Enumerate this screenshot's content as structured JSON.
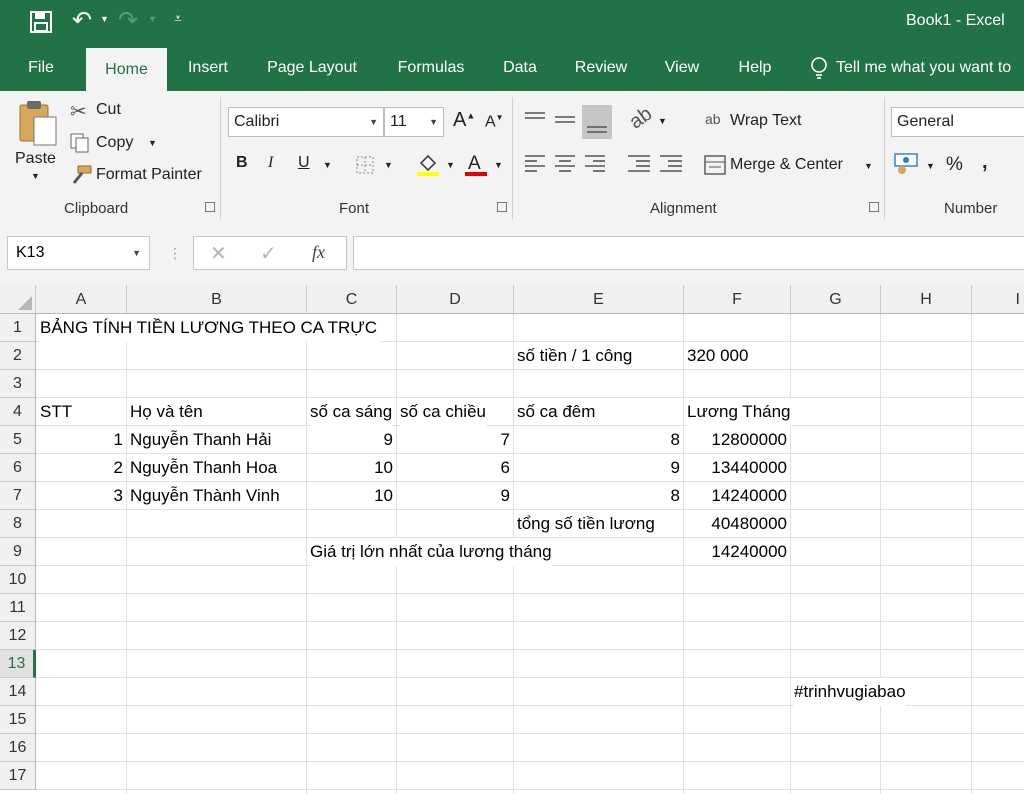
{
  "window": {
    "title": "Book1  -  Excel"
  },
  "tabs": [
    "File",
    "Home",
    "Insert",
    "Page Layout",
    "Formulas",
    "Data",
    "Review",
    "View",
    "Help"
  ],
  "tell_me": "Tell me what you want to",
  "clipboard": {
    "paste": "Paste",
    "cut": "Cut",
    "copy": "Copy",
    "format_painter": "Format Painter",
    "group": "Clipboard"
  },
  "font": {
    "name": "Calibri",
    "size": "11",
    "bold": "B",
    "italic": "I",
    "underline": "U",
    "group": "Font"
  },
  "alignment": {
    "wrap": "Wrap Text",
    "merge": "Merge & Center",
    "group": "Alignment"
  },
  "number": {
    "format": "General",
    "percent": "%",
    "comma": ",",
    "group": "Number"
  },
  "formula_bar": {
    "name_box": "K13",
    "fx": "fx",
    "value": ""
  },
  "columns": [
    "A",
    "B",
    "C",
    "D",
    "E",
    "F",
    "G",
    "H",
    "I"
  ],
  "rows": [
    "1",
    "2",
    "3",
    "4",
    "5",
    "6",
    "7",
    "8",
    "9",
    "10",
    "11",
    "12",
    "13",
    "14",
    "15",
    "16",
    "17"
  ],
  "cells": {
    "A1": "BẢNG TÍNH TIỀN LƯƠNG THEO CA TRỰC",
    "E2": "số tiền / 1 công",
    "F2": "320 000",
    "A4": "STT",
    "B4": "Họ và tên",
    "C4": "số ca sáng",
    "D4": "số ca chiều",
    "E4": "số ca đêm",
    "F4": "Lương Tháng",
    "A5": "1",
    "B5": "Nguyễn Thanh Hải",
    "C5": "9",
    "D5": "7",
    "E5": "8",
    "F5": "12800000",
    "A6": "2",
    "B6": "Nguyễn Thanh Hoa",
    "C6": "10",
    "D6": "6",
    "E6": "9",
    "F6": "13440000",
    "A7": "3",
    "B7": "Nguyễn Thành Vinh",
    "C7": "10",
    "D7": "9",
    "E7": "8",
    "F7": "14240000",
    "E8": "tổng số tiền lương",
    "F8": "40480000",
    "C9": "Giá trị lớn nhất của lương tháng",
    "F9": "14240000",
    "G14": "#trinhvugiabao"
  },
  "colors": {
    "brand": "#217346",
    "selected_row": "#217346"
  }
}
